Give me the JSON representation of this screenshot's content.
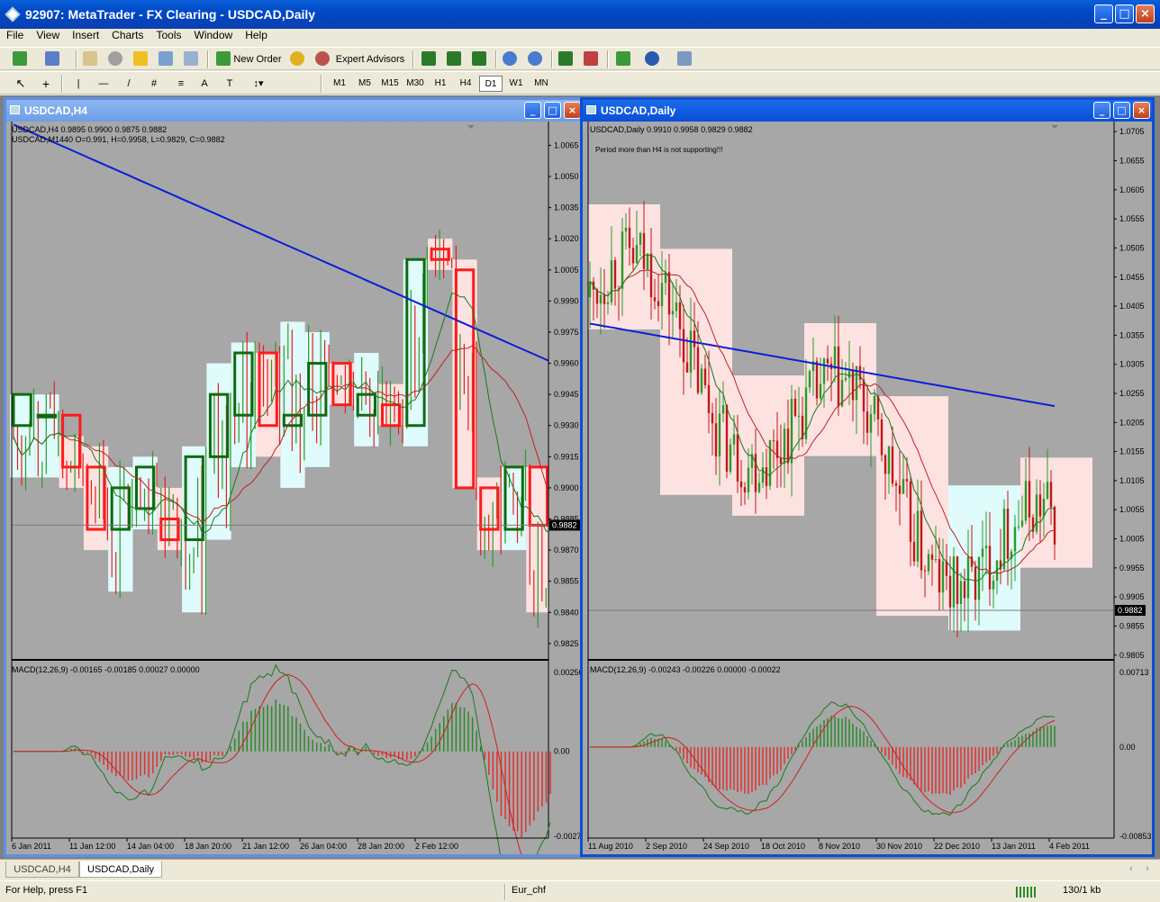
{
  "window": {
    "title": "92907: MetaTrader - FX Clearing - USDCAD,Daily"
  },
  "menu": [
    "File",
    "View",
    "Insert",
    "Charts",
    "Tools",
    "Window",
    "Help"
  ],
  "toolbar": {
    "new_order": "New Order",
    "expert_advisors": "Expert Advisors"
  },
  "timeframes": [
    "M1",
    "M5",
    "M15",
    "M30",
    "H1",
    "H4",
    "D1",
    "W1",
    "MN"
  ],
  "timeframe_selected": "D1",
  "charts": {
    "h4": {
      "title": "USDCAD,H4",
      "header1": "USDCAD,H4  0.9895 0.9900 0.9875 0.9882",
      "header2": "USDCAD,M1440   O=0.991, H=0.9958, L=0.9829, C=0.9882",
      "price_ticks": [
        "1.0065",
        "1.0050",
        "1.0035",
        "1.0020",
        "1.0005",
        "0.9990",
        "0.9975",
        "0.9960",
        "0.9945",
        "0.9930",
        "0.9915",
        "0.9900",
        "0.9885",
        "0.9870",
        "0.9855",
        "0.9840",
        "0.9825"
      ],
      "price_range": [
        0.9818,
        1.0073
      ],
      "current_price": "0.9882",
      "macd_label": "MACD(12,26,9) -0.00165 -0.00185 0.00027 0.00000",
      "macd_ticks": [
        "0.00256",
        "0.00",
        "-0.00275"
      ],
      "macd_range": [
        -0.00275,
        0.00256
      ],
      "date_labels": [
        "6 Jan 2011",
        "11 Jan 12:00",
        "14 Jan 04:00",
        "18 Jan 20:00",
        "21 Jan 12:00",
        "26 Jan 04:00",
        "28 Jan 20:00",
        "2 Feb 12:00"
      ],
      "daily_candles": [
        {
          "o": 0.993,
          "h": 0.9945,
          "l": 0.9905,
          "c": 0.9945
        },
        {
          "o": 0.9935,
          "h": 0.9945,
          "l": 0.9905,
          "c": 0.9935
        },
        {
          "o": 0.9935,
          "h": 0.9925,
          "l": 0.99,
          "c": 0.991
        },
        {
          "o": 0.991,
          "h": 0.992,
          "l": 0.987,
          "c": 0.988
        },
        {
          "o": 0.988,
          "h": 0.991,
          "l": 0.985,
          "c": 0.99
        },
        {
          "o": 0.989,
          "h": 0.9915,
          "l": 0.988,
          "c": 0.991
        },
        {
          "o": 0.9885,
          "h": 0.99,
          "l": 0.987,
          "c": 0.9875
        },
        {
          "o": 0.9875,
          "h": 0.992,
          "l": 0.984,
          "c": 0.9915
        },
        {
          "o": 0.9915,
          "h": 0.996,
          "l": 0.9875,
          "c": 0.9945
        },
        {
          "o": 0.9935,
          "h": 0.997,
          "l": 0.991,
          "c": 0.9965
        },
        {
          "o": 0.9965,
          "h": 0.9965,
          "l": 0.9915,
          "c": 0.993
        },
        {
          "o": 0.993,
          "h": 0.998,
          "l": 0.99,
          "c": 0.9935
        },
        {
          "o": 0.9935,
          "h": 0.9975,
          "l": 0.991,
          "c": 0.996
        },
        {
          "o": 0.996,
          "h": 0.996,
          "l": 0.994,
          "c": 0.994
        },
        {
          "o": 0.9935,
          "h": 0.9965,
          "l": 0.992,
          "c": 0.9945
        },
        {
          "o": 0.994,
          "h": 0.995,
          "l": 0.993,
          "c": 0.993
        },
        {
          "o": 0.993,
          "h": 1.001,
          "l": 0.992,
          "c": 1.001
        },
        {
          "o": 1.0015,
          "h": 1.002,
          "l": 1.0005,
          "c": 1.001
        },
        {
          "o": 1.0005,
          "h": 1.001,
          "l": 0.99,
          "c": 0.99
        },
        {
          "o": 0.99,
          "h": 0.9905,
          "l": 0.987,
          "c": 0.988
        },
        {
          "o": 0.988,
          "h": 0.991,
          "l": 0.987,
          "c": 0.991
        },
        {
          "o": 0.991,
          "h": 0.991,
          "l": 0.984,
          "c": 0.9882
        }
      ]
    },
    "daily": {
      "title": "USDCAD,Daily",
      "header1": "USDCAD,Daily   0.9910 0.9958 0.9829 0.9882",
      "notice": "Period more than H4 is not supporting!!!",
      "price_ticks": [
        "1.0705",
        "1.0655",
        "1.0605",
        "1.0555",
        "1.0505",
        "1.0455",
        "1.0405",
        "1.0355",
        "1.0305",
        "1.0255",
        "1.0205",
        "1.0155",
        "1.0105",
        "1.0055",
        "1.0005",
        "0.9955",
        "0.9905",
        "0.9855",
        "0.9805"
      ],
      "price_range": [
        0.98,
        1.071
      ],
      "current_price": "0.9882",
      "macd_label": "MACD(12,26,9) -0.00243 -0.00226 0.00000 -0.00022",
      "macd_ticks": [
        "0.00713",
        "0.00",
        "-0.00853"
      ],
      "macd_range": [
        -0.00853,
        0.00713
      ],
      "date_labels": [
        "11 Aug 2010",
        "2 Sep 2010",
        "24 Sep 2010",
        "18 Oct 2010",
        "8 Nov 2010",
        "30 Nov 2010",
        "22 Dec 2010",
        "13 Jan 2011",
        "4 Feb 2011"
      ]
    }
  },
  "tabs": [
    "USDCAD,H4",
    "USDCAD,Daily"
  ],
  "active_tab": "USDCAD,Daily",
  "status": {
    "help": "For Help, press F1",
    "profile": "Eur_chf",
    "traffic": "130/1 kb"
  }
}
